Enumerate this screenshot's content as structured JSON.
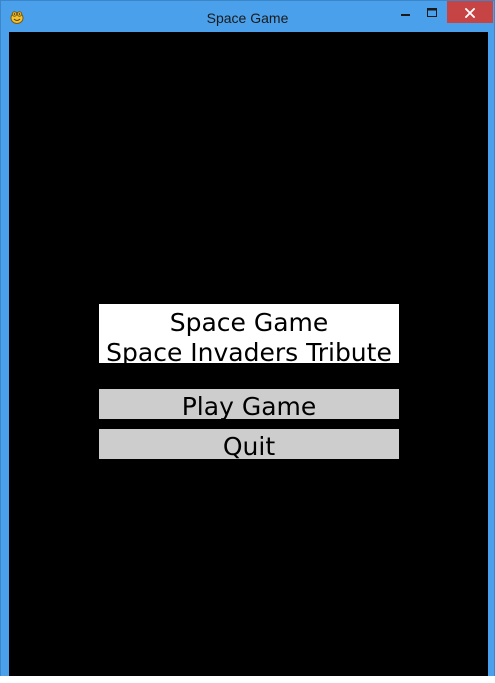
{
  "window": {
    "title": "Space Game",
    "icon": "pygame-snake-icon",
    "controls": {
      "minimize_icon": "minimize-icon",
      "maximize_icon": "maximize-icon",
      "close_icon": "close-icon"
    }
  },
  "menu": {
    "title_line_1": "Space Game",
    "title_line_2": "Space Invaders Tribute",
    "play_label": "Play Game",
    "quit_label": "Quit"
  },
  "colors": {
    "frame": "#4aa0ea",
    "close_button": "#c74444",
    "game_background": "#000000",
    "title_panel": "#ffffff",
    "button_background": "#cdcdcd",
    "text": "#000000"
  }
}
